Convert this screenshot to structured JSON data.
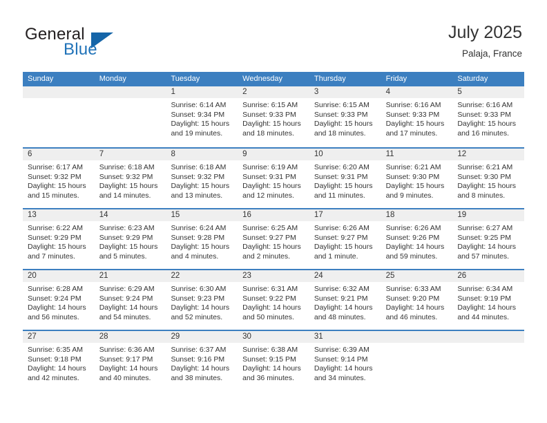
{
  "brand": {
    "word1": "General",
    "word2": "Blue",
    "logo_icon": "triangle-flag-icon",
    "colors": {
      "dark": "#231f20",
      "blue": "#1f72b8",
      "triangle": "#1565a8"
    }
  },
  "header": {
    "title": "July 2025",
    "subtitle": "Palaja, France"
  },
  "calendar": {
    "accent_color": "#3c7fc0",
    "day_band_color": "#efefef",
    "weekdays": [
      "Sunday",
      "Monday",
      "Tuesday",
      "Wednesday",
      "Thursday",
      "Friday",
      "Saturday"
    ],
    "weeks": [
      [
        {
          "empty": true
        },
        {
          "empty": true
        },
        {
          "day": "1",
          "lines": [
            "Sunrise: 6:14 AM",
            "Sunset: 9:34 PM",
            "Daylight: 15 hours",
            "and 19 minutes."
          ]
        },
        {
          "day": "2",
          "lines": [
            "Sunrise: 6:15 AM",
            "Sunset: 9:33 PM",
            "Daylight: 15 hours",
            "and 18 minutes."
          ]
        },
        {
          "day": "3",
          "lines": [
            "Sunrise: 6:15 AM",
            "Sunset: 9:33 PM",
            "Daylight: 15 hours",
            "and 18 minutes."
          ]
        },
        {
          "day": "4",
          "lines": [
            "Sunrise: 6:16 AM",
            "Sunset: 9:33 PM",
            "Daylight: 15 hours",
            "and 17 minutes."
          ]
        },
        {
          "day": "5",
          "lines": [
            "Sunrise: 6:16 AM",
            "Sunset: 9:33 PM",
            "Daylight: 15 hours",
            "and 16 minutes."
          ]
        }
      ],
      [
        {
          "day": "6",
          "lines": [
            "Sunrise: 6:17 AM",
            "Sunset: 9:32 PM",
            "Daylight: 15 hours",
            "and 15 minutes."
          ]
        },
        {
          "day": "7",
          "lines": [
            "Sunrise: 6:18 AM",
            "Sunset: 9:32 PM",
            "Daylight: 15 hours",
            "and 14 minutes."
          ]
        },
        {
          "day": "8",
          "lines": [
            "Sunrise: 6:18 AM",
            "Sunset: 9:32 PM",
            "Daylight: 15 hours",
            "and 13 minutes."
          ]
        },
        {
          "day": "9",
          "lines": [
            "Sunrise: 6:19 AM",
            "Sunset: 9:31 PM",
            "Daylight: 15 hours",
            "and 12 minutes."
          ]
        },
        {
          "day": "10",
          "lines": [
            "Sunrise: 6:20 AM",
            "Sunset: 9:31 PM",
            "Daylight: 15 hours",
            "and 11 minutes."
          ]
        },
        {
          "day": "11",
          "lines": [
            "Sunrise: 6:21 AM",
            "Sunset: 9:30 PM",
            "Daylight: 15 hours",
            "and 9 minutes."
          ]
        },
        {
          "day": "12",
          "lines": [
            "Sunrise: 6:21 AM",
            "Sunset: 9:30 PM",
            "Daylight: 15 hours",
            "and 8 minutes."
          ]
        }
      ],
      [
        {
          "day": "13",
          "lines": [
            "Sunrise: 6:22 AM",
            "Sunset: 9:29 PM",
            "Daylight: 15 hours",
            "and 7 minutes."
          ]
        },
        {
          "day": "14",
          "lines": [
            "Sunrise: 6:23 AM",
            "Sunset: 9:29 PM",
            "Daylight: 15 hours",
            "and 5 minutes."
          ]
        },
        {
          "day": "15",
          "lines": [
            "Sunrise: 6:24 AM",
            "Sunset: 9:28 PM",
            "Daylight: 15 hours",
            "and 4 minutes."
          ]
        },
        {
          "day": "16",
          "lines": [
            "Sunrise: 6:25 AM",
            "Sunset: 9:27 PM",
            "Daylight: 15 hours",
            "and 2 minutes."
          ]
        },
        {
          "day": "17",
          "lines": [
            "Sunrise: 6:26 AM",
            "Sunset: 9:27 PM",
            "Daylight: 15 hours",
            "and 1 minute."
          ]
        },
        {
          "day": "18",
          "lines": [
            "Sunrise: 6:26 AM",
            "Sunset: 9:26 PM",
            "Daylight: 14 hours",
            "and 59 minutes."
          ]
        },
        {
          "day": "19",
          "lines": [
            "Sunrise: 6:27 AM",
            "Sunset: 9:25 PM",
            "Daylight: 14 hours",
            "and 57 minutes."
          ]
        }
      ],
      [
        {
          "day": "20",
          "lines": [
            "Sunrise: 6:28 AM",
            "Sunset: 9:24 PM",
            "Daylight: 14 hours",
            "and 56 minutes."
          ]
        },
        {
          "day": "21",
          "lines": [
            "Sunrise: 6:29 AM",
            "Sunset: 9:24 PM",
            "Daylight: 14 hours",
            "and 54 minutes."
          ]
        },
        {
          "day": "22",
          "lines": [
            "Sunrise: 6:30 AM",
            "Sunset: 9:23 PM",
            "Daylight: 14 hours",
            "and 52 minutes."
          ]
        },
        {
          "day": "23",
          "lines": [
            "Sunrise: 6:31 AM",
            "Sunset: 9:22 PM",
            "Daylight: 14 hours",
            "and 50 minutes."
          ]
        },
        {
          "day": "24",
          "lines": [
            "Sunrise: 6:32 AM",
            "Sunset: 9:21 PM",
            "Daylight: 14 hours",
            "and 48 minutes."
          ]
        },
        {
          "day": "25",
          "lines": [
            "Sunrise: 6:33 AM",
            "Sunset: 9:20 PM",
            "Daylight: 14 hours",
            "and 46 minutes."
          ]
        },
        {
          "day": "26",
          "lines": [
            "Sunrise: 6:34 AM",
            "Sunset: 9:19 PM",
            "Daylight: 14 hours",
            "and 44 minutes."
          ]
        }
      ],
      [
        {
          "day": "27",
          "lines": [
            "Sunrise: 6:35 AM",
            "Sunset: 9:18 PM",
            "Daylight: 14 hours",
            "and 42 minutes."
          ]
        },
        {
          "day": "28",
          "lines": [
            "Sunrise: 6:36 AM",
            "Sunset: 9:17 PM",
            "Daylight: 14 hours",
            "and 40 minutes."
          ]
        },
        {
          "day": "29",
          "lines": [
            "Sunrise: 6:37 AM",
            "Sunset: 9:16 PM",
            "Daylight: 14 hours",
            "and 38 minutes."
          ]
        },
        {
          "day": "30",
          "lines": [
            "Sunrise: 6:38 AM",
            "Sunset: 9:15 PM",
            "Daylight: 14 hours",
            "and 36 minutes."
          ]
        },
        {
          "day": "31",
          "lines": [
            "Sunrise: 6:39 AM",
            "Sunset: 9:14 PM",
            "Daylight: 14 hours",
            "and 34 minutes."
          ]
        },
        {
          "empty": true
        },
        {
          "empty": true
        }
      ]
    ]
  }
}
